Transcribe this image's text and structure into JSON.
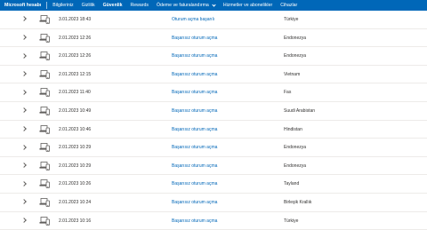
{
  "nav": {
    "brand": "Microsoft hesabı",
    "items": [
      {
        "label": "Bilgileriniz",
        "active": false,
        "dropdown": false
      },
      {
        "label": "Gizlilik",
        "active": false,
        "dropdown": false
      },
      {
        "label": "Güvenlik",
        "active": true,
        "dropdown": false
      },
      {
        "label": "Rewards",
        "active": false,
        "dropdown": false
      },
      {
        "label": "Ödeme ve faturalandırma",
        "active": false,
        "dropdown": true
      },
      {
        "label": "Hizmetler ve abonelikler",
        "active": false,
        "dropdown": false
      },
      {
        "label": "Cihazlar",
        "active": false,
        "dropdown": false
      }
    ]
  },
  "activity": [
    {
      "date": "3.01.2023 18:43",
      "status": "Oturum açma başarılı",
      "country": "Türkiye"
    },
    {
      "date": "2.01.2023 12:26",
      "status": "Başarısız oturum açma",
      "country": "Endonezya"
    },
    {
      "date": "2.01.2023 12:26",
      "status": "Başarısız oturum açma",
      "country": "Endonezya"
    },
    {
      "date": "2.01.2023 12:15",
      "status": "Başarısız oturum açma",
      "country": "Vietnam"
    },
    {
      "date": "2.01.2023 11:40",
      "status": "Başarısız oturum açma",
      "country": "Fas"
    },
    {
      "date": "2.01.2023 10:49",
      "status": "Başarısız oturum açma",
      "country": "Suudi Arabistan"
    },
    {
      "date": "2.01.2023 10:46",
      "status": "Başarısız oturum açma",
      "country": "Hindistan"
    },
    {
      "date": "2.01.2023 10:29",
      "status": "Başarısız oturum açma",
      "country": "Endonezya"
    },
    {
      "date": "2.01.2023 10:29",
      "status": "Başarısız oturum açma",
      "country": "Endonezya"
    },
    {
      "date": "2.01.2023 10:26",
      "status": "Başarısız oturum açma",
      "country": "Tayland"
    },
    {
      "date": "2.01.2023 10:24",
      "status": "Başarısız oturum açma",
      "country": "Birleşik Krallık"
    },
    {
      "date": "2.01.2023 10:16",
      "status": "Başarısız oturum açma",
      "country": "Türkiye"
    }
  ],
  "colors": {
    "accent": "#0067b8",
    "divider": "#edebe9"
  },
  "icons": {
    "device": "laptop-phone-icon",
    "expand": "chevron-right-icon",
    "dropdown": "chevron-down-icon"
  }
}
